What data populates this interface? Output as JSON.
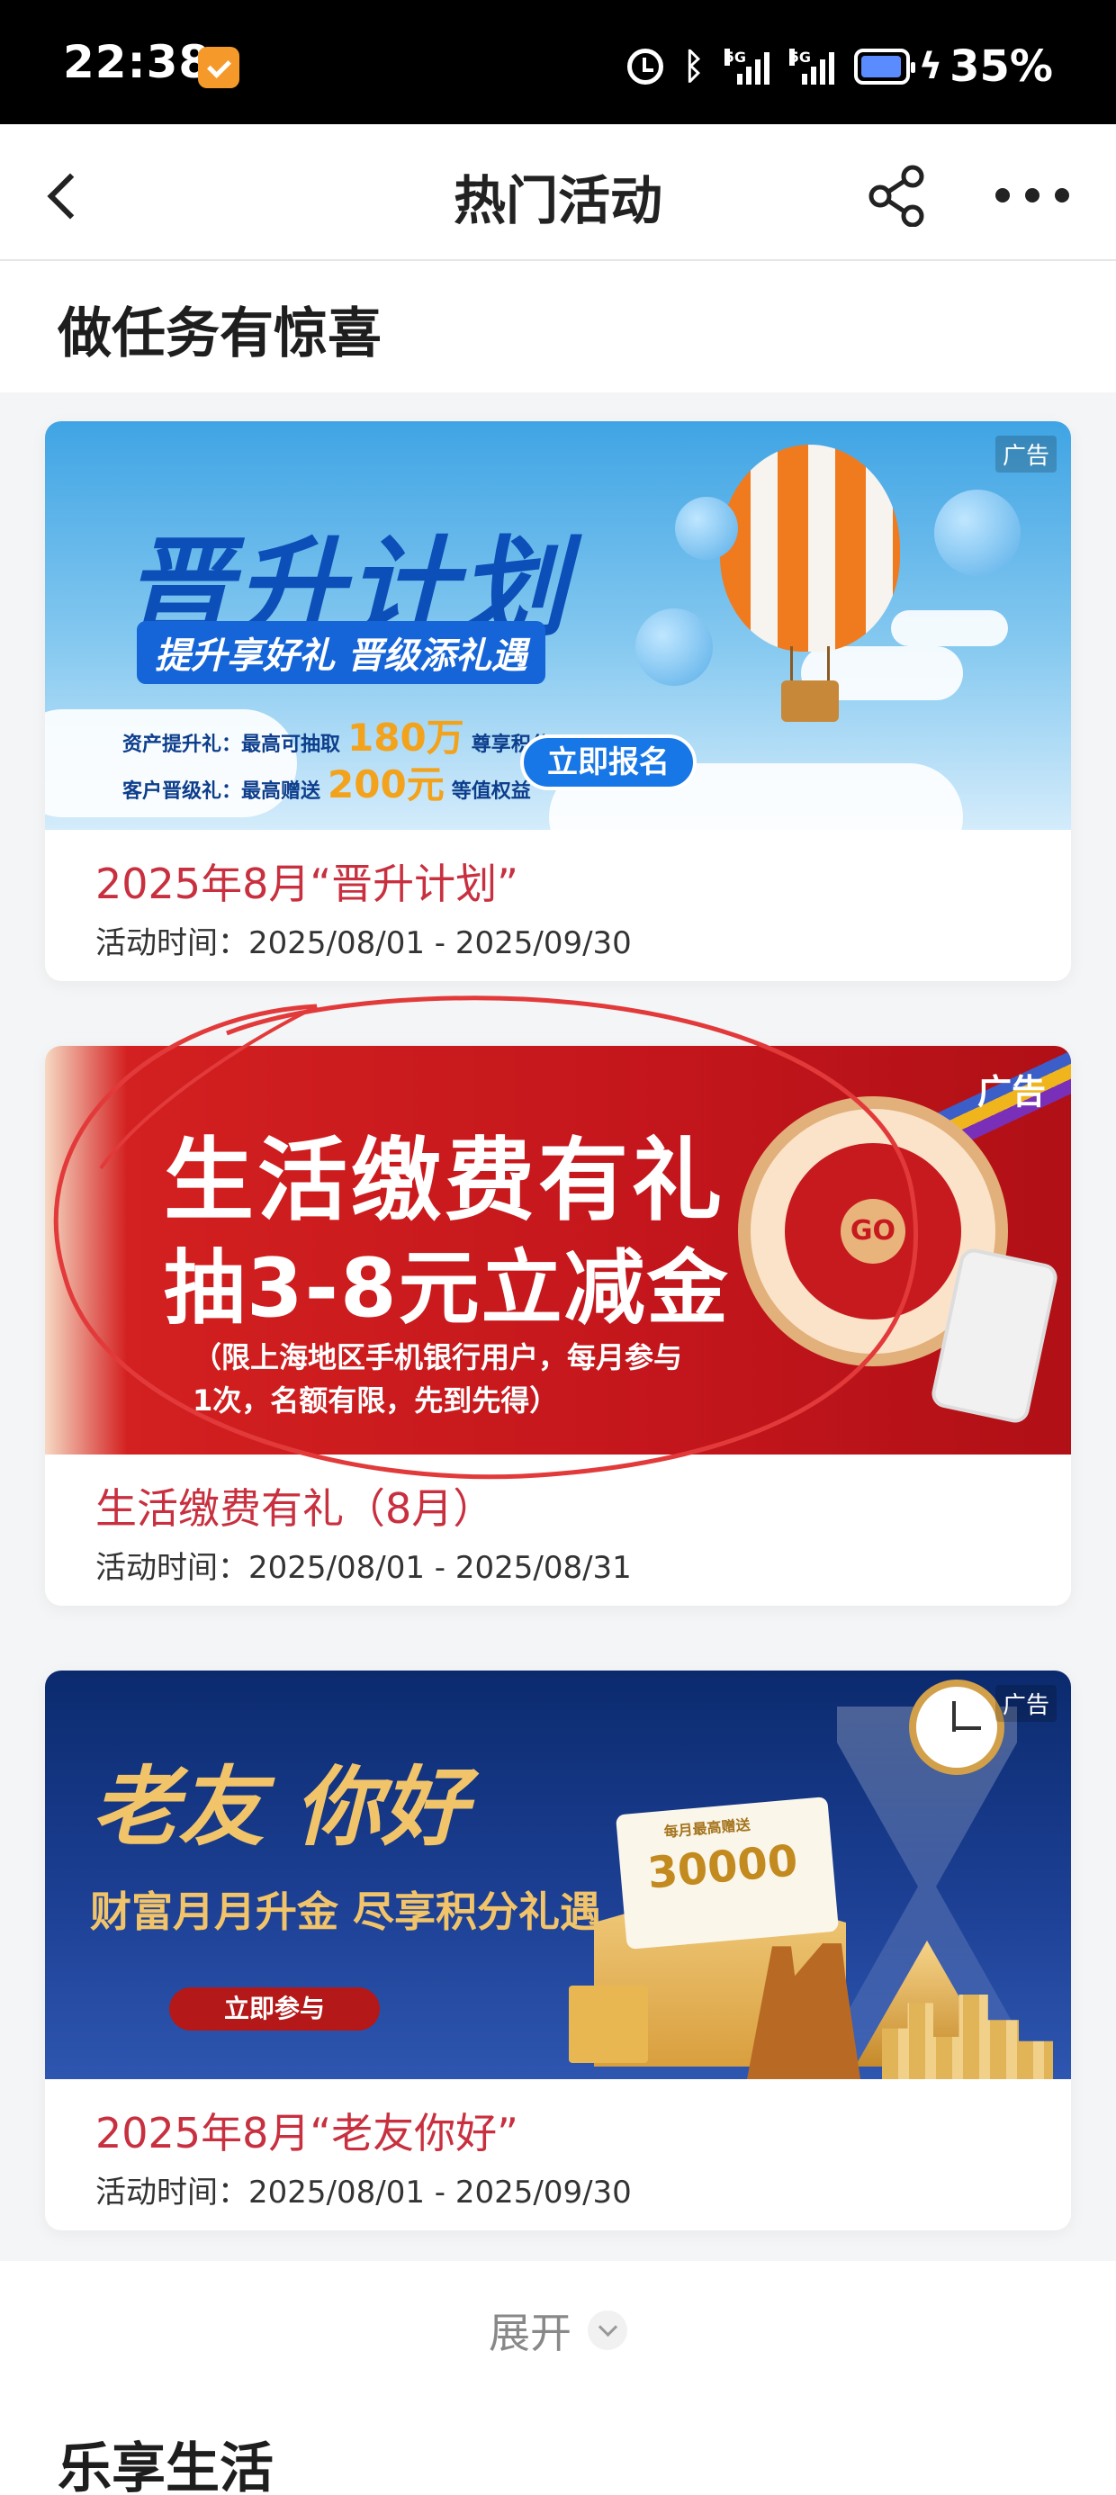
{
  "status_bar": {
    "time": "22:38",
    "signal1_label": "5G",
    "signal2_label": "5G",
    "battery_percent": "35%",
    "icons": [
      "app-notification-icon",
      "alarm-icon",
      "bluetooth-icon",
      "signal-icon",
      "battery-icon",
      "charging-icon"
    ]
  },
  "nav": {
    "title": "热门活动",
    "icons": [
      "back-arrow-icon",
      "share-icon",
      "more-icon"
    ]
  },
  "section1": {
    "title": "做任务有惊喜"
  },
  "cards": [
    {
      "title": "2025年8月“晋升计划”",
      "date": "活动时间：2025/08/01 - 2025/09/30",
      "banner": {
        "ad_tag": "广告",
        "headline": "晋升计划",
        "subtitle": "提升享好礼 晋级添礼遇",
        "row1_label": "资产提升礼：",
        "row1_mid": "最高可抽取",
        "row1_value": "180万",
        "row1_unit": "尊享积分",
        "row2_label": "客户晋级礼：",
        "row2_mid": "最高赠送",
        "row2_value": "200元",
        "row2_unit": "等值权益",
        "button": "立即报名"
      }
    },
    {
      "title": "生活缴费有礼（8月）",
      "date": "活动时间：2025/08/01 - 2025/08/31",
      "banner": {
        "ad_tag": "广告",
        "headline1": "生活缴费有礼",
        "headline2": "抽3-8元立减金",
        "note": "（限上海地区手机银行用户，每月参与1次，名额有限，先到先得）",
        "wheel_button": "GO"
      }
    },
    {
      "title": "2025年8月“老友你好”",
      "date": "活动时间：2025/08/01 - 2025/09/30",
      "banner": {
        "ad_tag": "广告",
        "headline": "老友 你好",
        "subtitle": "财富月月升金 尽享积分礼遇",
        "button": "立即参与",
        "card_small": "每月最高赠送",
        "card_value": "30000"
      }
    }
  ],
  "expand": {
    "label": "展开"
  },
  "section2": {
    "title": "乐享生活"
  },
  "colors": {
    "card_title": "#c8303f",
    "accent_blue": "#1877e6",
    "accent_red": "#c3161c"
  }
}
